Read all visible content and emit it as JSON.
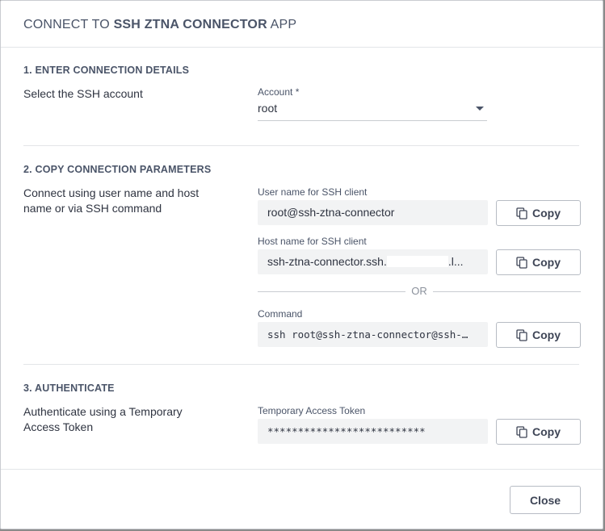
{
  "dialog": {
    "title_prefix": "CONNECT TO",
    "title_app": "SSH ZTNA CONNECTOR",
    "title_suffix": "APP"
  },
  "section1": {
    "title": "1. ENTER CONNECTION DETAILS",
    "description": "Select the SSH account",
    "account_label": "Account *",
    "account_value": "root"
  },
  "section2": {
    "title": "2. COPY CONNECTION PARAMETERS",
    "description": "Connect using user name and host name or via SSH command",
    "username_label": "User name for SSH client",
    "username_value": "root@ssh-ztna-connector",
    "hostname_label": "Host name for SSH client",
    "hostname_value_start": "ssh-ztna-connector.ssh.",
    "hostname_value_end": ".l...",
    "or_text": "OR",
    "command_label": "Command",
    "command_value": "ssh root@ssh-ztna-connector@ssh-…"
  },
  "section3": {
    "title": "3. AUTHENTICATE",
    "description": "Authenticate using a Temporary Access Token",
    "token_label": "Temporary Access Token",
    "token_value": "**************************"
  },
  "buttons": {
    "copy_label": "Copy",
    "close_label": "Close"
  },
  "icons": {
    "copy": "copy-icon",
    "dropdown": "caret-down-icon"
  },
  "colors": {
    "text_heading": "#4a5468",
    "text_body": "#2f3441",
    "field_bg": "#f2f3f4",
    "border": "#b7bcc4"
  }
}
